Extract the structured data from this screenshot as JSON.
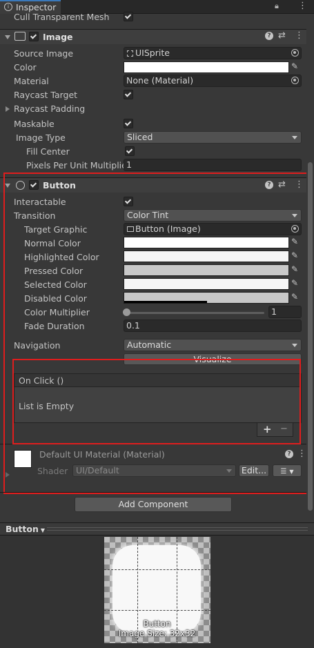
{
  "window": {
    "tab_title": "Inspector"
  },
  "canvas_group": {
    "cull_label": "Cull Transparent Mesh",
    "cull_checked": true
  },
  "image_component": {
    "title": "Image",
    "enabled": true,
    "source_image_label": "Source Image",
    "source_image_value": "UISprite",
    "color_label": "Color",
    "color_value": "#ffffff",
    "material_label": "Material",
    "material_value": "None (Material)",
    "raycast_target_label": "Raycast Target",
    "raycast_target_checked": true,
    "raycast_padding_label": "Raycast Padding",
    "maskable_label": "Maskable",
    "maskable_checked": true,
    "image_type_label": "Image Type",
    "image_type_value": "Sliced",
    "fill_center_label": "Fill Center",
    "fill_center_checked": true,
    "ppu_label": "Pixels Per Unit Multiplier",
    "ppu_value": "1"
  },
  "button_component": {
    "title": "Button",
    "enabled": true,
    "interactable_label": "Interactable",
    "interactable_checked": true,
    "transition_label": "Transition",
    "transition_value": "Color Tint",
    "target_graphic_label": "Target Graphic",
    "target_graphic_value": "Button (Image)",
    "normal_color_label": "Normal Color",
    "normal_color": "#ffffff",
    "highlighted_color_label": "Highlighted Color",
    "highlighted_color": "#f5f5f5",
    "pressed_color_label": "Pressed Color",
    "pressed_color": "#c8c8c8",
    "selected_color_label": "Selected Color",
    "selected_color": "#f5f5f5",
    "disabled_color_label": "Disabled Color",
    "disabled_color": "#c8c8c8",
    "color_multiplier_label": "Color Multiplier",
    "color_multiplier_value": "1",
    "fade_duration_label": "Fade Duration",
    "fade_duration_value": "0.1",
    "navigation_label": "Navigation",
    "navigation_value": "Automatic",
    "visualize_label": "Visualize",
    "on_click_label": "On Click ()",
    "list_empty_label": "List is Empty",
    "add_label": "+",
    "remove_label": "−"
  },
  "material_section": {
    "title": "Default UI Material (Material)",
    "shader_label": "Shader",
    "shader_value": "UI/Default",
    "edit_label": "Edit..."
  },
  "add_component_label": "Add Component",
  "preview": {
    "title": "Button",
    "name_label": "Button",
    "size_label": "Image Size: 32x32"
  }
}
